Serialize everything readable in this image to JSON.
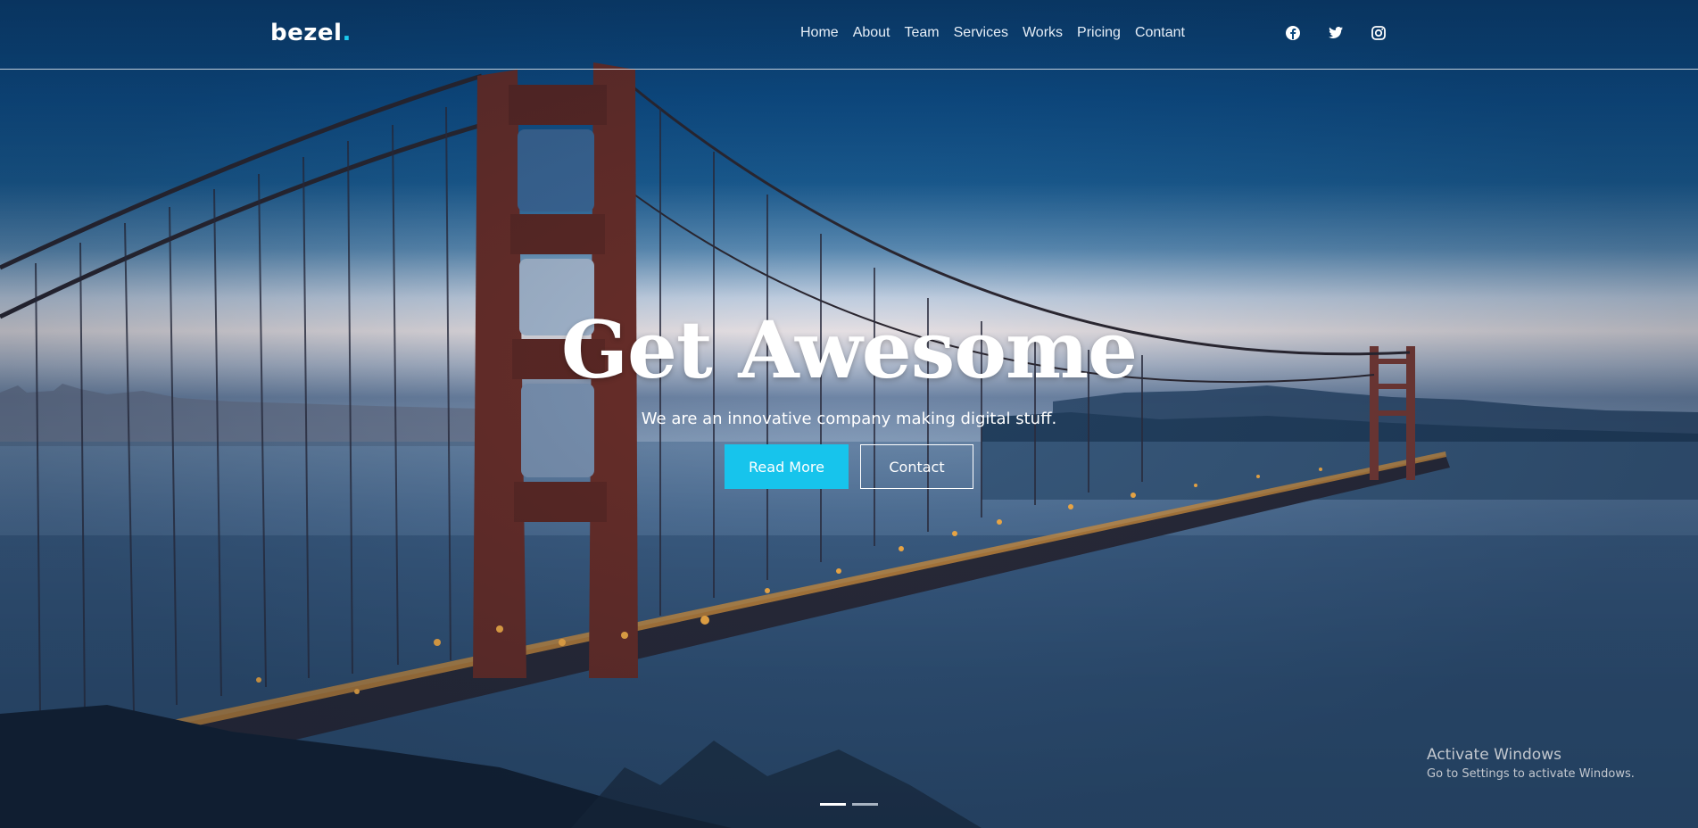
{
  "brand": {
    "name": "bezel",
    "dot": "."
  },
  "nav": {
    "items": [
      "Home",
      "About",
      "Team",
      "Services",
      "Works",
      "Pricing",
      "Contant"
    ]
  },
  "social": [
    "facebook-icon",
    "twitter-icon",
    "instagram-icon"
  ],
  "hero": {
    "title": "Get Awesome",
    "subtitle": "We are an innovative company making digital stuff.",
    "primary_button": "Read More",
    "secondary_button": "Contact",
    "slides_total": 2,
    "active_slide": 1
  },
  "watermark": {
    "title": "Activate Windows",
    "subtitle": "Go to Settings to activate Windows."
  },
  "colors": {
    "accent": "#17c4ec",
    "text": "#ffffff"
  }
}
